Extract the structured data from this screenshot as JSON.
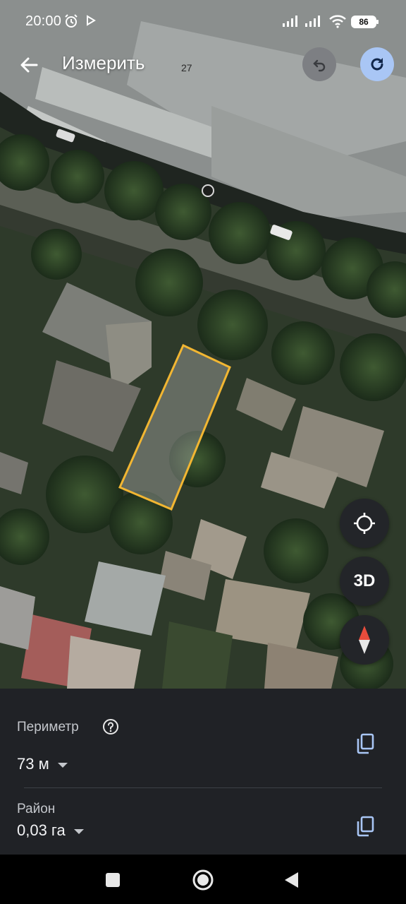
{
  "status_bar": {
    "time": "20:00",
    "battery_level": "86",
    "icons": [
      "alarm-icon",
      "play-icon",
      "signal-icon",
      "signal-icon",
      "wifi-icon",
      "battery-icon"
    ]
  },
  "map": {
    "tile_label": "27",
    "style": "satellite",
    "polygon_color": "#f2b632"
  },
  "app_bar": {
    "title": "Измерить",
    "back_icon": "arrow-left-icon",
    "undo_icon": "undo-icon",
    "redo_icon": "redo-icon",
    "redo_color": "#a9c6f5"
  },
  "map_controls": {
    "locate_icon": "crosshair-icon",
    "three_d_label": "3D",
    "compass_icon": "compass-icon"
  },
  "measurements": {
    "perimeter": {
      "label": "Периметр",
      "value": "73 м",
      "help_icon": "help-icon",
      "copy_icon": "copy-icon"
    },
    "area": {
      "label": "Район",
      "value": "0,03 га",
      "copy_icon": "copy-icon"
    }
  },
  "nav_bar": {
    "icons": [
      "square-recents-icon",
      "circle-home-icon",
      "triangle-back-icon"
    ]
  },
  "colors": {
    "sheet_background": "#202226",
    "accent_copy": "#a9c6f5"
  }
}
